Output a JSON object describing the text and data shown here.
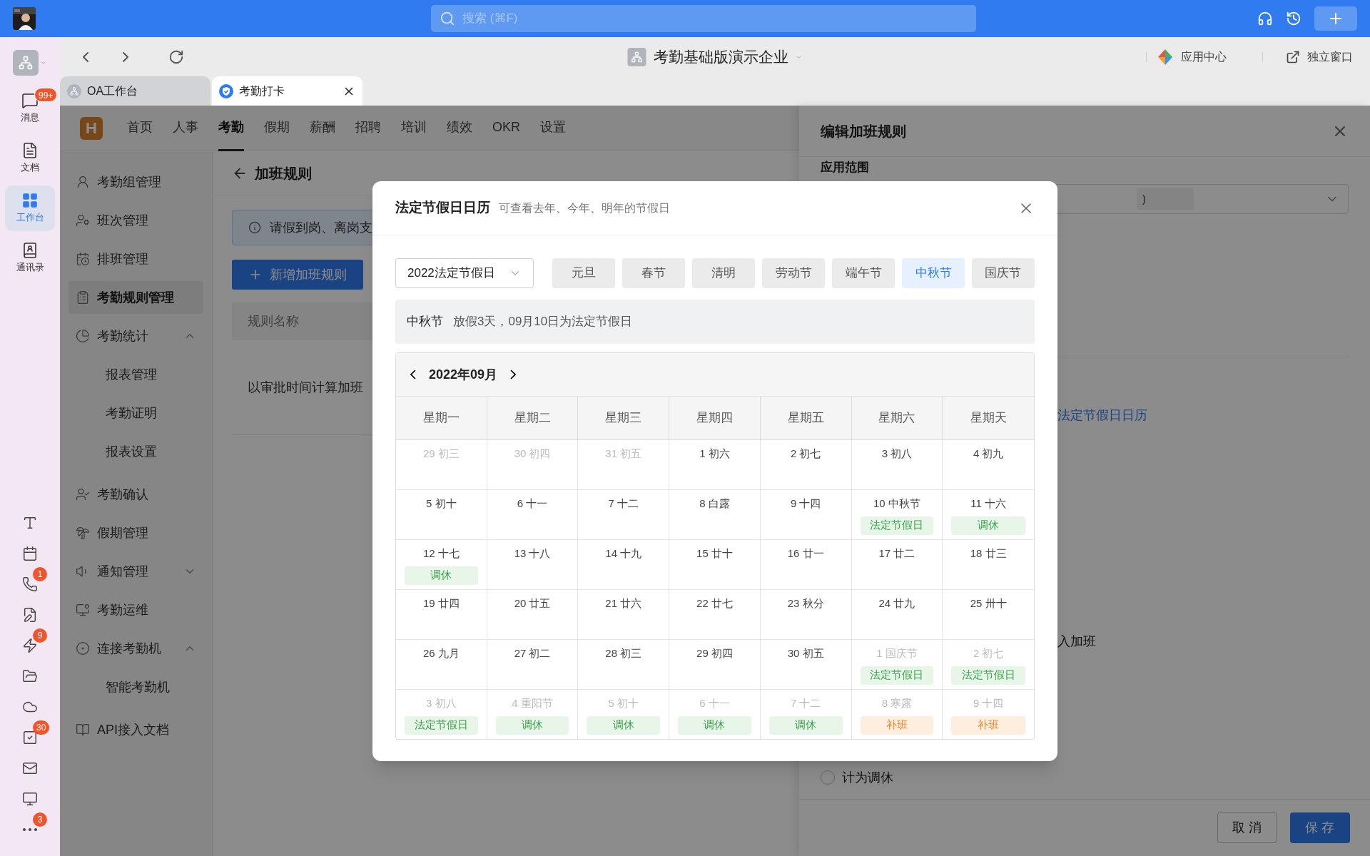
{
  "topbar": {
    "search_placeholder": "搜索 (⌘F)"
  },
  "rail": {
    "items": [
      {
        "label": "消息",
        "badge": "99+",
        "selected": false
      },
      {
        "label": "文档",
        "selected": false
      },
      {
        "label": "工作台",
        "selected": true
      },
      {
        "label": "通讯录",
        "selected": false
      }
    ],
    "tools": [
      {
        "kind": "text"
      },
      {
        "kind": "calendar"
      },
      {
        "kind": "phone",
        "badge": "1"
      },
      {
        "kind": "note"
      },
      {
        "kind": "lightning",
        "badge": "9"
      },
      {
        "kind": "folder"
      },
      {
        "kind": "cloud"
      },
      {
        "kind": "task",
        "badge": "30"
      },
      {
        "kind": "mail"
      },
      {
        "kind": "monitor"
      },
      {
        "kind": "more",
        "badge": "3"
      }
    ]
  },
  "browser": {
    "org_title": "考勤基础版演示企业",
    "app_center": "应用中心",
    "standalone": "独立窗口",
    "tabs": [
      {
        "label": "OA工作台",
        "selected": false
      },
      {
        "label": "考勤打卡",
        "selected": true
      }
    ]
  },
  "app": {
    "logo": "H",
    "nav": [
      {
        "label": "首页",
        "selected": false
      },
      {
        "label": "人事",
        "selected": false
      },
      {
        "label": "考勤",
        "selected": true
      },
      {
        "label": "假期",
        "selected": false
      },
      {
        "label": "薪酬",
        "selected": false
      },
      {
        "label": "招聘",
        "selected": false
      },
      {
        "label": "培训",
        "selected": false
      },
      {
        "label": "绩效",
        "selected": false
      },
      {
        "label": "OKR",
        "selected": false
      },
      {
        "label": "设置",
        "selected": false
      }
    ],
    "menu": [
      {
        "label": "考勤组管理",
        "selected": false
      },
      {
        "label": "班次管理",
        "selected": false
      },
      {
        "label": "排班管理",
        "selected": false
      },
      {
        "label": "考勤规则管理",
        "selected": true
      },
      {
        "label": "考勤统计",
        "selected": false,
        "expanded": true,
        "children": [
          {
            "label": "报表管理",
            "selected": false
          },
          {
            "label": "考勤证明",
            "selected": false
          },
          {
            "label": "报表设置",
            "selected": false
          }
        ]
      },
      {
        "label": "考勤确认",
        "selected": false
      },
      {
        "label": "假期管理",
        "selected": false
      },
      {
        "label": "通知管理",
        "selected": false,
        "expanded": false
      },
      {
        "label": "考勤运维",
        "selected": false
      },
      {
        "label": "连接考勤机",
        "selected": false,
        "expanded": true,
        "children": [
          {
            "label": "智能考勤机",
            "selected": false
          }
        ]
      },
      {
        "label": "API接入文档",
        "selected": false
      }
    ],
    "page_title": "加班规则",
    "notice": "请假到岗、离岗支",
    "add_button": "新增加班规则",
    "table": {
      "columns": [
        "规则名称"
      ],
      "rows": [
        [
          "以审批时间计算加班"
        ]
      ]
    }
  },
  "drawer": {
    "title": "编辑加班规则",
    "scope_label": "应用范围",
    "scope_chip": ")",
    "link": "法定节假日日历",
    "text_fragment": "入加班",
    "radio": {
      "label": "计为调休",
      "selected": false
    },
    "cancel": "取 消",
    "save": "保 存"
  },
  "modal": {
    "title": "法定节假日日历",
    "subtitle": "可查看去年、今年、明年的节假日",
    "year_select": "2022法定节假日",
    "holidays": [
      {
        "label": "元旦",
        "selected": false
      },
      {
        "label": "春节",
        "selected": false
      },
      {
        "label": "清明",
        "selected": false
      },
      {
        "label": "劳动节",
        "selected": false
      },
      {
        "label": "端午节",
        "selected": false
      },
      {
        "label": "中秋节",
        "selected": true
      },
      {
        "label": "国庆节",
        "selected": false
      }
    ],
    "info": {
      "name": "中秋节",
      "text": "放假3天，09月10日为法定节假日"
    },
    "month": "2022年09月",
    "weekdays": [
      "星期一",
      "星期二",
      "星期三",
      "星期四",
      "星期五",
      "星期六",
      "星期天"
    ],
    "weeks": [
      [
        {
          "day": "29",
          "lunar": "初三",
          "muted": true
        },
        {
          "day": "30",
          "lunar": "初四",
          "muted": true
        },
        {
          "day": "31",
          "lunar": "初五",
          "muted": true
        },
        {
          "day": "1",
          "lunar": "初六",
          "muted": false
        },
        {
          "day": "2",
          "lunar": "初七",
          "muted": false
        },
        {
          "day": "3",
          "lunar": "初八",
          "muted": false
        },
        {
          "day": "4",
          "lunar": "初九",
          "muted": false
        }
      ],
      [
        {
          "day": "5",
          "lunar": "初十",
          "muted": false
        },
        {
          "day": "6",
          "lunar": "十一",
          "muted": false
        },
        {
          "day": "7",
          "lunar": "十二",
          "muted": false
        },
        {
          "day": "8",
          "lunar": "白露",
          "muted": false
        },
        {
          "day": "9",
          "lunar": "十四",
          "muted": false
        },
        {
          "day": "10",
          "lunar": "中秋节",
          "muted": false,
          "tag": {
            "kind": "holiday",
            "text": "法定节假日"
          }
        },
        {
          "day": "11",
          "lunar": "十六",
          "muted": false,
          "tag": {
            "kind": "rest",
            "text": "调休"
          }
        }
      ],
      [
        {
          "day": "12",
          "lunar": "十七",
          "muted": false,
          "tag": {
            "kind": "rest",
            "text": "调休"
          }
        },
        {
          "day": "13",
          "lunar": "十八",
          "muted": false
        },
        {
          "day": "14",
          "lunar": "十九",
          "muted": false
        },
        {
          "day": "15",
          "lunar": "廿十",
          "muted": false
        },
        {
          "day": "16",
          "lunar": "廿一",
          "muted": false
        },
        {
          "day": "17",
          "lunar": "廿二",
          "muted": false
        },
        {
          "day": "18",
          "lunar": "廿三",
          "muted": false
        }
      ],
      [
        {
          "day": "19",
          "lunar": "廿四",
          "muted": false
        },
        {
          "day": "20",
          "lunar": "廿五",
          "muted": false
        },
        {
          "day": "21",
          "lunar": "廿六",
          "muted": false
        },
        {
          "day": "22",
          "lunar": "廿七",
          "muted": false
        },
        {
          "day": "23",
          "lunar": "秋分",
          "muted": false
        },
        {
          "day": "24",
          "lunar": "廿九",
          "muted": false
        },
        {
          "day": "25",
          "lunar": "卅十",
          "muted": false
        }
      ],
      [
        {
          "day": "26",
          "lunar": "九月",
          "muted": false
        },
        {
          "day": "27",
          "lunar": "初二",
          "muted": false
        },
        {
          "day": "28",
          "lunar": "初三",
          "muted": false
        },
        {
          "day": "29",
          "lunar": "初四",
          "muted": false
        },
        {
          "day": "30",
          "lunar": "初五",
          "muted": false
        },
        {
          "day": "1",
          "lunar": "国庆节",
          "muted": true,
          "tag": {
            "kind": "holiday",
            "text": "法定节假日"
          }
        },
        {
          "day": "2",
          "lunar": "初七",
          "muted": true,
          "tag": {
            "kind": "holiday",
            "text": "法定节假日"
          }
        }
      ],
      [
        {
          "day": "3",
          "lunar": "初八",
          "muted": true,
          "tag": {
            "kind": "holiday",
            "text": "法定节假日"
          }
        },
        {
          "day": "4",
          "lunar": "重阳节",
          "muted": true,
          "tag": {
            "kind": "rest",
            "text": "调休"
          }
        },
        {
          "day": "5",
          "lunar": "初十",
          "muted": true,
          "tag": {
            "kind": "rest",
            "text": "调休"
          }
        },
        {
          "day": "6",
          "lunar": "十一",
          "muted": true,
          "tag": {
            "kind": "rest",
            "text": "调休"
          }
        },
        {
          "day": "7",
          "lunar": "十二",
          "muted": true,
          "tag": {
            "kind": "rest",
            "text": "调休"
          }
        },
        {
          "day": "8",
          "lunar": "寒露",
          "muted": true,
          "tag": {
            "kind": "work",
            "text": "补班"
          }
        },
        {
          "day": "9",
          "lunar": "十四",
          "muted": true,
          "tag": {
            "kind": "work",
            "text": "补班"
          }
        }
      ]
    ]
  }
}
